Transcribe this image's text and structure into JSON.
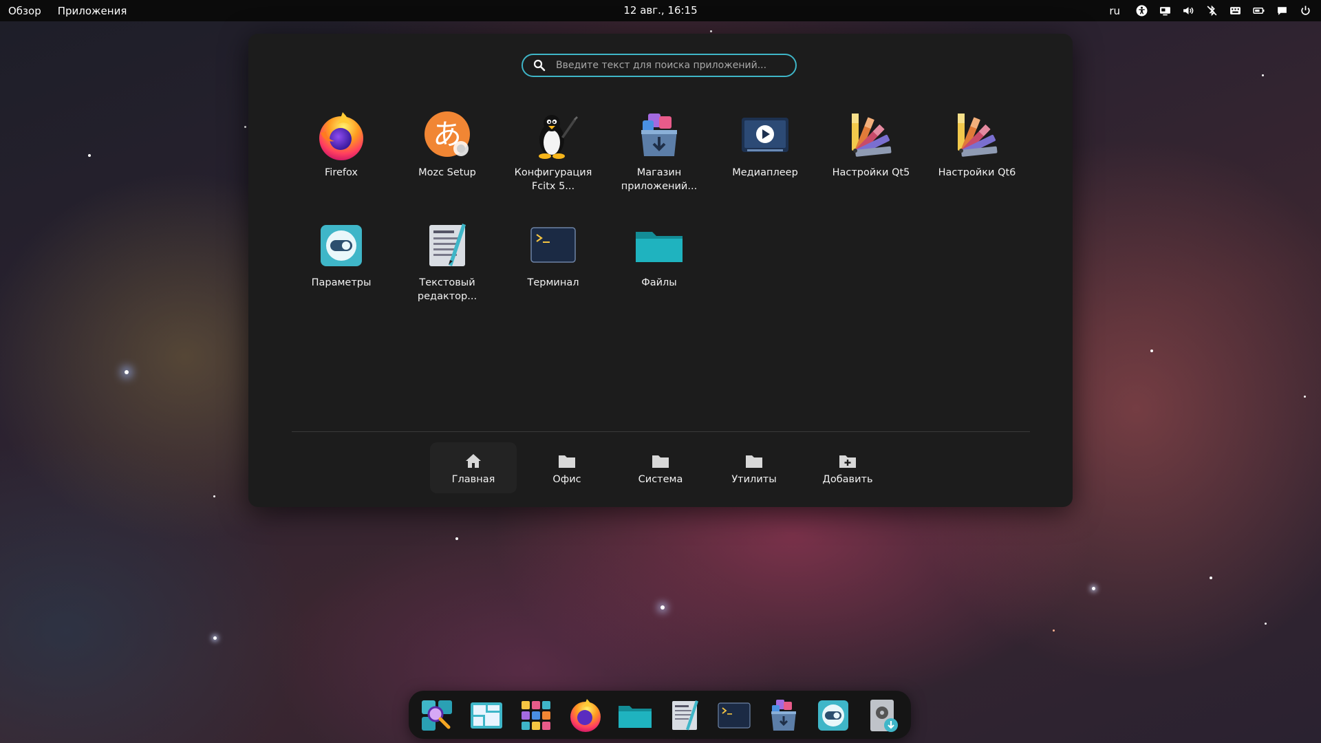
{
  "topbar": {
    "overview": "Обзор",
    "applications": "Приложения",
    "datetime": "12 авг., 16:15",
    "language": "ru",
    "tray_icons": [
      "accessibility-icon",
      "screen-share-icon",
      "volume-icon",
      "bluetooth-off-icon",
      "keyboard-icon",
      "battery-icon",
      "chat-icon",
      "power-icon"
    ]
  },
  "search": {
    "placeholder": "Введите текст для поиска приложений..."
  },
  "apps": [
    {
      "label": "Firefox",
      "icon": "firefox-icon"
    },
    {
      "label": "Mozc Setup",
      "icon": "mozc-icon"
    },
    {
      "label": "Конфигурация Fcitx 5...",
      "icon": "tux-icon"
    },
    {
      "label": "Магазин приложений...",
      "icon": "app-store-icon"
    },
    {
      "label": "Медиаплеер",
      "icon": "media-player-icon"
    },
    {
      "label": "Настройки Qt5",
      "icon": "qt5-settings-icon"
    },
    {
      "label": "Настройки Qt6",
      "icon": "qt6-settings-icon"
    },
    {
      "label": "Параметры",
      "icon": "settings-icon"
    },
    {
      "label": "Текстовый редактор...",
      "icon": "text-editor-icon"
    },
    {
      "label": "Терминал",
      "icon": "terminal-icon"
    },
    {
      "label": "Файлы",
      "icon": "files-icon"
    }
  ],
  "categories": [
    {
      "label": "Главная",
      "icon": "home-icon",
      "active": true
    },
    {
      "label": "Офис",
      "icon": "folder-icon"
    },
    {
      "label": "Система",
      "icon": "folder-icon"
    },
    {
      "label": "Утилиты",
      "icon": "folder-icon"
    },
    {
      "label": "Добавить",
      "icon": "folder-add-icon"
    }
  ],
  "dock": [
    "search-apps-icon",
    "workspaces-icon",
    "app-grid-icon",
    "firefox-icon",
    "files-icon",
    "text-editor-icon",
    "terminal-icon",
    "app-store-icon",
    "settings-icon",
    "installer-icon"
  ],
  "colors": {
    "accent": "#3fb6c8",
    "panel": "#1c1c1c",
    "topbar": "#0b0b0b",
    "dock": "#151515"
  }
}
